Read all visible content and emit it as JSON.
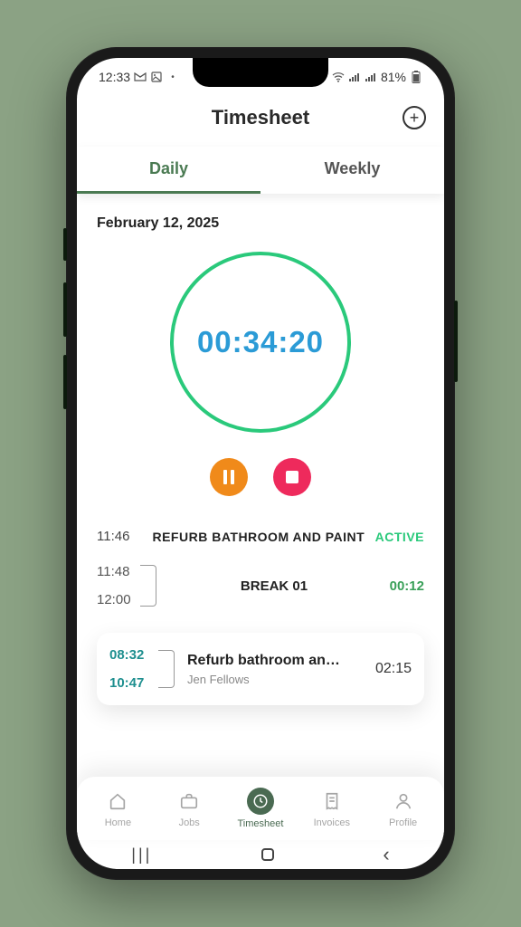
{
  "statusbar": {
    "time": "12:33",
    "battery": "81%"
  },
  "header": {
    "title": "Timesheet"
  },
  "tabs": {
    "daily": "Daily",
    "weekly": "Weekly"
  },
  "date": "February 12, 2025",
  "timer": {
    "value": "00:34:20"
  },
  "current_entry": {
    "start": "11:46",
    "title": "REFURB BATHROOM AND PAINT",
    "status": "ACTIVE"
  },
  "break": {
    "start": "11:48",
    "end": "12:00",
    "label": "BREAK 01",
    "duration": "00:12"
  },
  "past_entry": {
    "start": "08:32",
    "end": "10:47",
    "title": "Refurb bathroom an…",
    "client": "Jen Fellows",
    "duration": "02:15"
  },
  "nav": {
    "home": "Home",
    "jobs": "Jobs",
    "timesheet": "Timesheet",
    "invoices": "Invoices",
    "profile": "Profile"
  }
}
